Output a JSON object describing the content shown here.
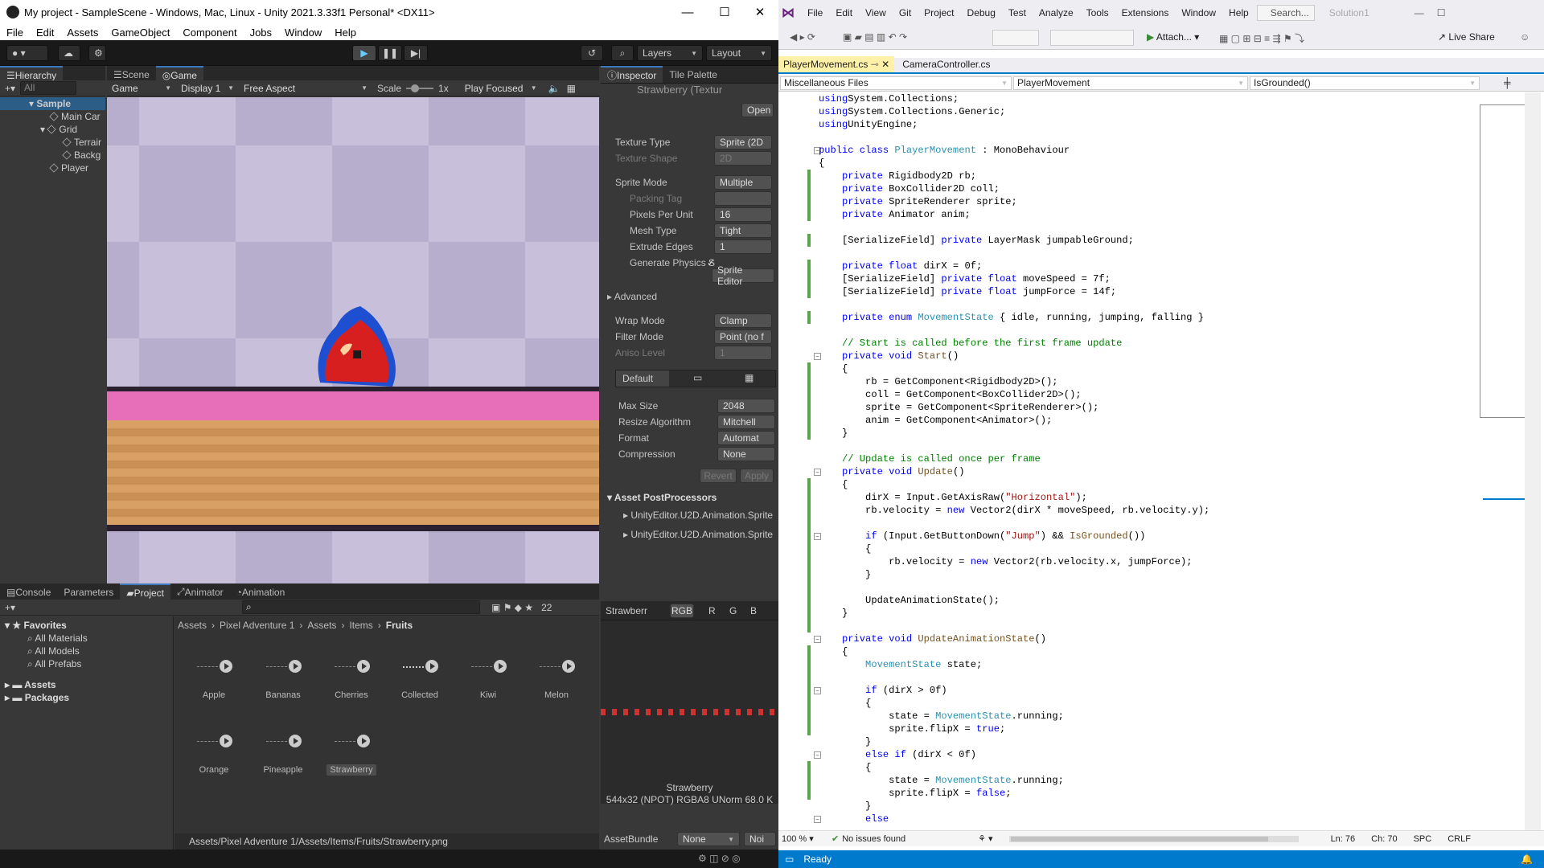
{
  "unity": {
    "title": "My project - SampleScene - Windows, Mac, Linux - Unity 2021.3.33f1 Personal* <DX11>",
    "menu": [
      "File",
      "Edit",
      "Assets",
      "GameObject",
      "Component",
      "Jobs",
      "Window",
      "Help"
    ],
    "toolbar": {
      "layers": "Layers",
      "layout": "Layout"
    },
    "hierarchy": {
      "tab": "Hierarchy",
      "search_placeholder": "All",
      "items": [
        "Sample",
        "Main Car",
        "Grid",
        "Terrair",
        "Backg",
        "Player"
      ]
    },
    "scene_tabs": [
      "Scene",
      "Game"
    ],
    "game_bar": {
      "mode": "Game",
      "display": "Display 1",
      "aspect": "Free Aspect",
      "scale_label": "Scale",
      "scale_value": "1x",
      "play_focused": "Play Focused"
    },
    "inspector": {
      "tabs": [
        "Inspector",
        "Tile Palette"
      ],
      "object": "Strawberry (Textur",
      "open": "Open",
      "rows": [
        {
          "label": "Texture Type",
          "value": "Sprite (2D"
        },
        {
          "label": "Texture Shape",
          "value": "2D"
        },
        {
          "label": "Sprite Mode",
          "value": "Multiple"
        },
        {
          "label": "Packing Tag",
          "value": ""
        },
        {
          "label": "Pixels Per Unit",
          "value": "16"
        },
        {
          "label": "Mesh Type",
          "value": "Tight"
        },
        {
          "label": "Extrude Edges",
          "value": "1"
        },
        {
          "label": "Generate Physics S",
          "value": "✓"
        }
      ],
      "sprite_editor": "Sprite Editor",
      "advanced": "Advanced",
      "rows2": [
        {
          "label": "Wrap Mode",
          "value": "Clamp"
        },
        {
          "label": "Filter Mode",
          "value": "Point (no f"
        },
        {
          "label": "Aniso Level",
          "value": "1"
        }
      ],
      "platform_tab": "Default",
      "rows3": [
        {
          "label": "Max Size",
          "value": "2048"
        },
        {
          "label": "Resize Algorithm",
          "value": "Mitchell"
        },
        {
          "label": "Format",
          "value": "Automat"
        },
        {
          "label": "Compression",
          "value": "None"
        }
      ],
      "revert": "Revert",
      "apply": "Apply",
      "postprocessors": "Asset PostProcessors",
      "pp_items": [
        "UnityEditor.U2D.Animation.Sprite",
        "UnityEditor.U2D.Animation.Sprite"
      ],
      "preview": {
        "name": "Strawberr",
        "channels": [
          "RGB",
          "R",
          "G",
          "B"
        ],
        "caption": "Strawberry",
        "info": "544x32 (NPOT)  RGBA8 UNorm   68.0 K"
      },
      "assetbundle": {
        "label": "AssetBundle",
        "value": "None",
        "variant": "Noi"
      }
    },
    "bottom_tabs": [
      "Console",
      "Parameters",
      "Project",
      "Animator",
      "Animation"
    ],
    "project": {
      "count": "22",
      "favorites": "Favorites",
      "fav_items": [
        "All Materials",
        "All Models",
        "All Prefabs"
      ],
      "folders": [
        "Assets",
        "Packages"
      ],
      "breadcrumb": [
        "Assets",
        "Pixel Adventure 1",
        "Assets",
        "Items",
        "Fruits"
      ],
      "fruits": [
        "Apple",
        "Bananas",
        "Cherries",
        "Collected",
        "Kiwi",
        "Melon",
        "Orange",
        "Pineapple",
        "Strawberry"
      ],
      "path": "Assets/Pixel Adventure 1/Assets/Items/Fruits/Strawberry.png"
    }
  },
  "vs": {
    "menu": [
      "File",
      "Edit",
      "View",
      "Git",
      "Project",
      "Debug",
      "Test",
      "Analyze",
      "Tools",
      "Extensions",
      "Window",
      "Help"
    ],
    "search": "Search...",
    "solution": "Solution1",
    "attach": "Attach...",
    "liveshare": "Live Share",
    "tabs": [
      "PlayerMovement.cs",
      "CameraController.cs"
    ],
    "nav": {
      "files": "Miscellaneous Files",
      "class": "PlayerMovement",
      "member": "IsGrounded()"
    },
    "zoom": "100 %",
    "issues": "No issues found",
    "ln": "Ln: 76",
    "ch": "Ch: 70",
    "spc": "SPC",
    "crlf": "CRLF",
    "status": "Ready",
    "code": [
      [
        [
          "kw",
          "using"
        ],
        [
          "",
          "System.Collections;"
        ]
      ],
      [
        [
          "kw",
          "using"
        ],
        [
          "",
          "System.Collections.Generic;"
        ]
      ],
      [
        [
          "kw",
          "using"
        ],
        [
          "",
          "UnityEngine;"
        ]
      ],
      [],
      [
        [
          "kw",
          "public class "
        ],
        [
          "ty",
          "PlayerMovement"
        ],
        [
          "",
          " : MonoBehaviour"
        ]
      ],
      [
        [
          "",
          "{"
        ]
      ],
      [
        [
          "kw",
          "    private "
        ],
        [
          "",
          "Rigidbody2D rb;"
        ]
      ],
      [
        [
          "kw",
          "    private "
        ],
        [
          "",
          "BoxCollider2D coll;"
        ]
      ],
      [
        [
          "kw",
          "    private "
        ],
        [
          "",
          "SpriteRenderer sprite;"
        ]
      ],
      [
        [
          "kw",
          "    private "
        ],
        [
          "",
          "Animator anim;"
        ]
      ],
      [],
      [
        [
          "",
          "    [SerializeField] "
        ],
        [
          "kw",
          "private "
        ],
        [
          "",
          "LayerMask jumpableGround;"
        ]
      ],
      [],
      [
        [
          "kw",
          "    private float "
        ],
        [
          "",
          "dirX = 0f;"
        ]
      ],
      [
        [
          "",
          "    [SerializeField] "
        ],
        [
          "kw",
          "private float "
        ],
        [
          "",
          "moveSpeed = 7f;"
        ]
      ],
      [
        [
          "",
          "    [SerializeField] "
        ],
        [
          "kw",
          "private float "
        ],
        [
          "",
          "jumpForce = 14f;"
        ]
      ],
      [],
      [
        [
          "kw",
          "    private enum "
        ],
        [
          "ty",
          "MovementState"
        ],
        [
          "",
          " { idle, running, jumping, falling }"
        ]
      ],
      [],
      [
        [
          "cm",
          "    // Start is called before the first frame update"
        ]
      ],
      [
        [
          "kw",
          "    private void "
        ],
        [
          "ch",
          "Start"
        ],
        [
          "",
          "()"
        ]
      ],
      [
        [
          "",
          "    {"
        ]
      ],
      [
        [
          "",
          "        rb = GetComponent<Rigidbody2D>();"
        ]
      ],
      [
        [
          "",
          "        coll = GetComponent<BoxCollider2D>();"
        ]
      ],
      [
        [
          "",
          "        sprite = GetComponent<SpriteRenderer>();"
        ]
      ],
      [
        [
          "",
          "        anim = GetComponent<Animator>();"
        ]
      ],
      [
        [
          "",
          "    }"
        ]
      ],
      [],
      [
        [
          "cm",
          "    // Update is called once per frame"
        ]
      ],
      [
        [
          "kw",
          "    private void "
        ],
        [
          "ch",
          "Update"
        ],
        [
          "",
          "()"
        ]
      ],
      [
        [
          "",
          "    {"
        ]
      ],
      [
        [
          "",
          "        dirX = Input.GetAxisRaw("
        ],
        [
          "st",
          "\"Horizontal\""
        ],
        [
          "",
          ");"
        ]
      ],
      [
        [
          "",
          "        rb.velocity = "
        ],
        [
          "kw",
          "new "
        ],
        [
          "",
          "Vector2(dirX * moveSpeed, rb.velocity.y);"
        ]
      ],
      [],
      [
        [
          "kw",
          "        if "
        ],
        [
          "",
          "(Input.GetButtonDown("
        ],
        [
          "st",
          "\"Jump\""
        ],
        [
          "",
          ") && "
        ],
        [
          "ch",
          "IsGrounded"
        ],
        [
          "",
          "())"
        ]
      ],
      [
        [
          "",
          "        {"
        ]
      ],
      [
        [
          "",
          "            rb.velocity = "
        ],
        [
          "kw",
          "new "
        ],
        [
          "",
          "Vector2(rb.velocity.x, jumpForce);"
        ]
      ],
      [
        [
          "",
          "        }"
        ]
      ],
      [],
      [
        [
          "",
          "        UpdateAnimationState();"
        ]
      ],
      [
        [
          "",
          "    }"
        ]
      ],
      [],
      [
        [
          "kw",
          "    private void "
        ],
        [
          "ch",
          "UpdateAnimationState"
        ],
        [
          "",
          "()"
        ]
      ],
      [
        [
          "",
          "    {"
        ]
      ],
      [
        [
          "ty",
          "        MovementState"
        ],
        [
          "",
          " state;"
        ]
      ],
      [],
      [
        [
          "kw",
          "        if "
        ],
        [
          "",
          "(dirX > 0f)"
        ]
      ],
      [
        [
          "",
          "        {"
        ]
      ],
      [
        [
          "",
          "            state = "
        ],
        [
          "ty",
          "MovementState"
        ],
        [
          "",
          ".running;"
        ]
      ],
      [
        [
          "",
          "            sprite.flipX = "
        ],
        [
          "kw",
          "true"
        ],
        [
          ";"
        ]
      ],
      [
        [
          "",
          "        }"
        ]
      ],
      [
        [
          "kw",
          "        else if "
        ],
        [
          "",
          "(dirX < 0f)"
        ]
      ],
      [
        [
          "",
          "        {"
        ]
      ],
      [
        [
          "",
          "            state = "
        ],
        [
          "ty",
          "MovementState"
        ],
        [
          "",
          ".running;"
        ]
      ],
      [
        [
          "",
          "            sprite.flipX = "
        ],
        [
          "kw",
          "false"
        ],
        [
          ";"
        ]
      ],
      [
        [
          "",
          "        }"
        ]
      ],
      [
        [
          "kw",
          "        else"
        ]
      ]
    ]
  }
}
